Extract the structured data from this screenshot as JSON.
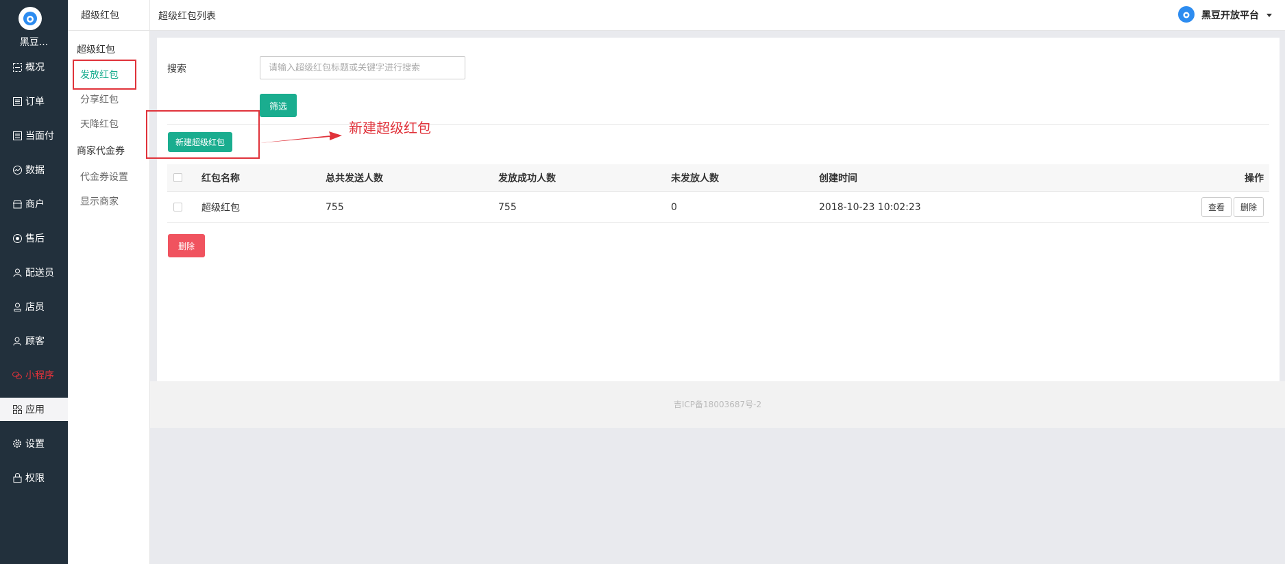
{
  "nav": {
    "brand": "黑豆...",
    "items": [
      {
        "label": "概况",
        "icon": "overview-icon"
      },
      {
        "label": "订单",
        "icon": "order-icon"
      },
      {
        "label": "当面付",
        "icon": "pay-icon"
      },
      {
        "label": "数据",
        "icon": "data-icon"
      },
      {
        "label": "商户",
        "icon": "store-icon"
      },
      {
        "label": "售后",
        "icon": "aftersale-icon"
      },
      {
        "label": "配送员",
        "icon": "courier-icon"
      },
      {
        "label": "店员",
        "icon": "clerk-icon"
      },
      {
        "label": "顾客",
        "icon": "customer-icon"
      },
      {
        "label": "小程序",
        "icon": "miniprogram-icon"
      },
      {
        "label": "应用",
        "icon": "apps-icon"
      },
      {
        "label": "设置",
        "icon": "gear-icon"
      },
      {
        "label": "权限",
        "icon": "lock-icon"
      }
    ]
  },
  "subnav": {
    "header": "超级红包",
    "group1": "超级红包",
    "items1": [
      "发放红包",
      "分享红包",
      "天降红包"
    ],
    "group2": "商家代金券",
    "items2": [
      "代金券设置",
      "显示商家"
    ]
  },
  "header": {
    "title": "超级红包列表",
    "platform": "黑豆开放平台"
  },
  "filter": {
    "search_label": "搜索",
    "search_placeholder": "请输入超级红包标题或关键字进行搜索",
    "filter_button": "筛选",
    "new_button": "新建超级红包"
  },
  "annotation": {
    "text": "新建超级红包",
    "color": "#e0323a"
  },
  "table": {
    "headers": [
      "红包名称",
      "总共发送人数",
      "发放成功人数",
      "未发放人数",
      "创建时间",
      "操作"
    ],
    "rows": [
      {
        "name": "超级红包",
        "total": "755",
        "success": "755",
        "pending": "0",
        "created": "2018-10-23 10:02:23",
        "view": "查看",
        "delete": "删除"
      }
    ]
  },
  "bulk_delete": "删除",
  "footer": "吉ICP备18003687号-2",
  "colors": {
    "accent": "#1aad8f",
    "danger": "#f0535f",
    "nav_bg": "#22303c"
  }
}
